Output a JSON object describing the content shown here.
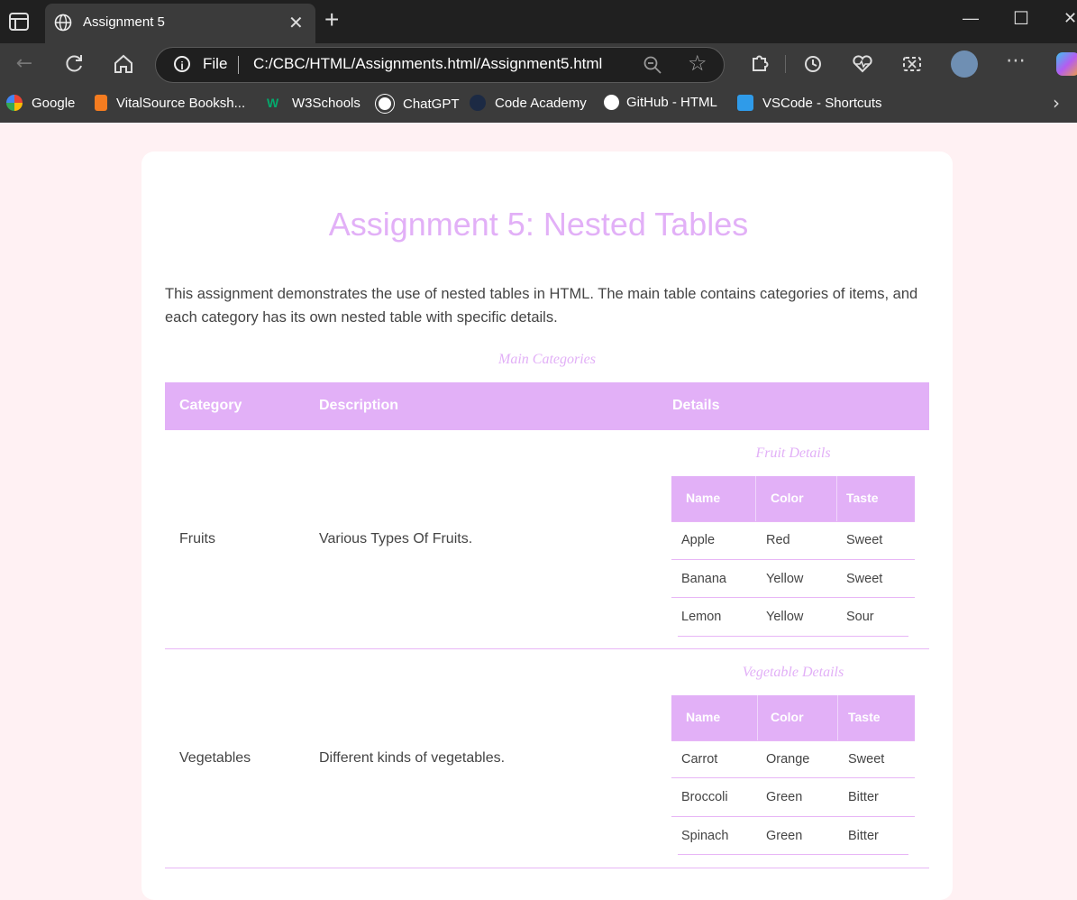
{
  "browser": {
    "tab_title": "Assignment 5",
    "url_prefix": "File",
    "url": "C:/CBC/HTML/Assignments.html/Assignment5.html",
    "bookmarks": [
      "Google",
      "VitalSource Booksh...",
      "W3Schools",
      "ChatGPT",
      "Code Academy",
      "GitHub - HTML",
      "VSCode - Shortcuts"
    ]
  },
  "page": {
    "title": "Assignment 5: Nested Tables",
    "intro_line1": "This assignment demonstrates the use of nested tables in HTML. The main table contains categories of items, and",
    "intro_line2": "each category has its own nested table with specific details.",
    "main_caption": "Main Categories",
    "headers": [
      "Category",
      "Description",
      "Details"
    ],
    "rows": [
      {
        "category": "Fruits",
        "description": "Various Types Of Fruits.",
        "details_caption": "Fruit Details",
        "columns": [
          "Name",
          "Color",
          "Taste"
        ],
        "items": [
          [
            "Apple",
            "Red",
            "Sweet"
          ],
          [
            "Banana",
            "Yellow",
            "Sweet"
          ],
          [
            "Lemon",
            "Yellow",
            "Sour"
          ]
        ]
      },
      {
        "category": "Vegetables",
        "description": "Different kinds of vegetables.",
        "details_caption": "Vegetable Details",
        "columns": [
          "Name",
          "Color",
          "Taste"
        ],
        "items": [
          [
            "Carrot",
            "Orange",
            "Sweet"
          ],
          [
            "Broccoli",
            "Green",
            "Bitter"
          ],
          [
            "Spinach",
            "Green",
            "Bitter"
          ]
        ]
      }
    ]
  },
  "colors": {
    "accent": "#e2b0f7",
    "page_bg": "#fff1f3",
    "text": "#444444"
  }
}
